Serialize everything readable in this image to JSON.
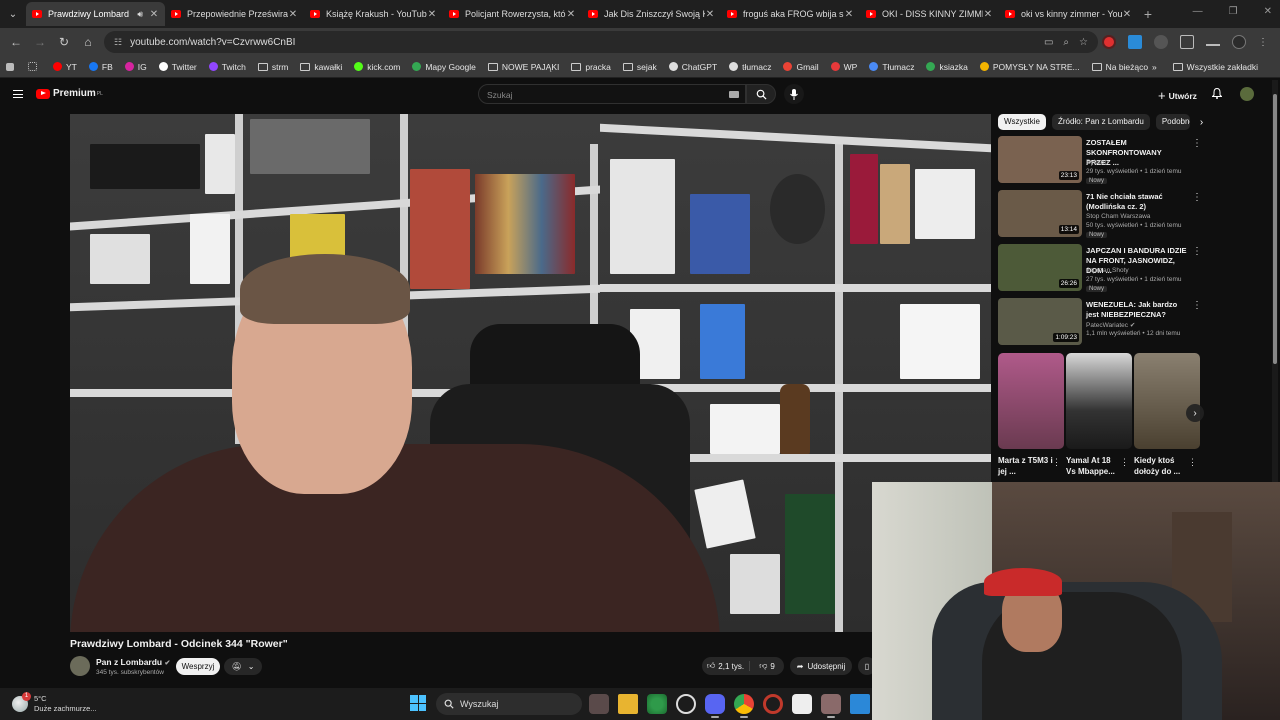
{
  "browser": {
    "tabs": [
      {
        "title": "Prawdziwy Lombard",
        "active": true,
        "audio": true
      },
      {
        "title": "Przepowiednie Prześwira"
      },
      {
        "title": "Książę Krakush - YouTube"
      },
      {
        "title": "Policjant Rowerzysta, któr"
      },
      {
        "title": "Jak Dis Zniszczył Swoją Ka"
      },
      {
        "title": "froguś aka FROG wbija si"
      },
      {
        "title": "OKI - DISS KINNY ZIMME"
      },
      {
        "title": "oki vs kinny zimmer - You"
      }
    ],
    "url": "youtube.com/watch?v=Czvrww6CnBI",
    "bookmarks": [
      {
        "label": "YT",
        "icon": "youtube-icon",
        "color": "#ff0000"
      },
      {
        "label": "FB",
        "icon": "facebook-icon",
        "color": "#1877f2"
      },
      {
        "label": "IG",
        "icon": "instagram-icon",
        "color": "#d6249f"
      },
      {
        "label": "Twitter",
        "icon": "x-icon",
        "color": "#ffffff"
      },
      {
        "label": "Twitch",
        "icon": "twitch-icon",
        "color": "#9146ff"
      },
      {
        "label": "strm",
        "icon": "folder-icon"
      },
      {
        "label": "kawałki",
        "icon": "folder-icon"
      },
      {
        "label": "kick.com",
        "icon": "kick-icon",
        "color": "#53fc18"
      },
      {
        "label": "Mapy Google",
        "icon": "maps-icon",
        "color": "#34a853"
      },
      {
        "label": "NOWE PAJĄKI",
        "icon": "folder-icon"
      },
      {
        "label": "pracka",
        "icon": "folder-icon"
      },
      {
        "label": "sejak",
        "icon": "folder-icon"
      },
      {
        "label": "ChatGPT",
        "icon": "chatgpt-icon",
        "color": "#dddddd"
      },
      {
        "label": "tłumacz",
        "icon": "translate-icon",
        "color": "#dddddd"
      },
      {
        "label": "Gmail",
        "icon": "gmail-icon",
        "color": "#ea4335"
      },
      {
        "label": "WP",
        "icon": "wp-icon",
        "color": "#e6393a"
      },
      {
        "label": "Tłumacz",
        "icon": "translate-icon",
        "color": "#4a8af4"
      },
      {
        "label": "ksiazka",
        "icon": "sheets-icon",
        "color": "#34a853"
      },
      {
        "label": "POMYSŁY NA STRE...",
        "icon": "sheets-icon",
        "color": "#f4b400"
      },
      {
        "label": "Na bieżąco",
        "icon": "folder-icon"
      }
    ],
    "all_bookmarks": "Wszystkie zakładki"
  },
  "youtube": {
    "logo": "Premium",
    "logo_region": "PL",
    "search_placeholder": "Szukaj",
    "create_label": "Utwórz",
    "chips": [
      "Wszystkie",
      "Źródło: Pan z Lombardu",
      "Podobne"
    ],
    "recommendations": [
      {
        "title": "ZOSTAŁEM SKONFRONTOWANY PRZEZ ...",
        "channel": "Rybson",
        "meta": "29 tys. wyświetleń • 1 dzień temu",
        "badge": "Nowy",
        "duration": "23:13",
        "color": "#7a6250"
      },
      {
        "title": "71 Nie chciała stawać (Modlińska cz. 2)",
        "channel": "Stop Cham Warszawa",
        "meta": "50 tys. wyświetleń • 1 dzień temu",
        "badge": "Nowy",
        "duration": "13:14",
        "color": "#6a5a48"
      },
      {
        "title": "JAPCZAN I BANDURA IDZIE NA FRONT, JASNOWIDZ, DOM ...",
        "channel": "Japczan Shoty",
        "meta": "27 tys. wyświetleń • 1 dzień temu",
        "badge": "Nowy",
        "duration": "26:26",
        "color": "#4d5a38"
      },
      {
        "title": "WENEZUELA: Jak bardzo jest NIEBEZPIECZNA?",
        "channel": "PatecWariatec",
        "meta": "1,1 mln wyświetleń • 12 dni temu",
        "badge": "",
        "duration": "1:09:23",
        "color": "#5a5a48"
      }
    ],
    "shorts": [
      {
        "title": "Marta z T5M3 i jej ...",
        "color": "#8a4a70"
      },
      {
        "title": "Yamal At 18 Vs Mbappe...",
        "color": "#3a3a3a"
      },
      {
        "title": "Kiedy ktoś dołoży do ...",
        "color": "#6a6050"
      }
    ],
    "video": {
      "title": "Prawdziwy Lombard - Odcinek 344 \"Rower\"",
      "channel": "Pan z Lombardu",
      "subscribers": "345 tys. subskrybentów",
      "support_label": "Wesprzyj",
      "likes": "2,1 tys.",
      "dislikes": "9",
      "share_label": "Udostępnij"
    }
  },
  "taskbar": {
    "weather_temp": "5°C",
    "weather_desc": "Duże zachmurze...",
    "weather_badge": "1",
    "search_label": "Wyszukaj"
  }
}
